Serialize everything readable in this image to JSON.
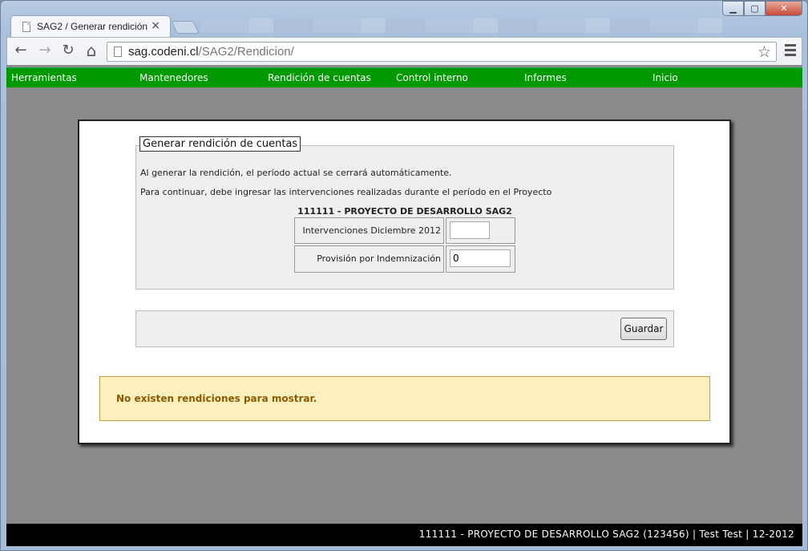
{
  "browser": {
    "tab_title": "SAG2 / Generar rendición",
    "tab_close": "×",
    "url_host": "sag.codeni.cl",
    "url_path": "/SAG2/Rendicion/",
    "window_buttons": {
      "minimize": "▁",
      "maximize": "▢",
      "close": "✕"
    },
    "nav": {
      "back": "←",
      "forward": "→",
      "reload": "↻",
      "home": "⌂",
      "star": "☆"
    }
  },
  "topnav": {
    "items": [
      "Herramientas",
      "Mantenedores",
      "Rendición de cuentas",
      "Control interno",
      "Informes",
      "Inicio"
    ]
  },
  "form": {
    "legend": "Generar rendición de cuentas",
    "intro_1": "Al generar la rendición, el período actual se cerrará automáticamente.",
    "intro_2": "Para continuar, debe ingresar las intervenciones realizadas durante el período en el Proyecto",
    "project_title": "111111 - PROYECTO DE DESARROLLO SAG2",
    "rows": [
      {
        "label": "Intervenciones Diciembre 2012",
        "value": ""
      },
      {
        "label": "Provisión por Indemnización",
        "value": "0"
      }
    ],
    "save_label": "Guardar"
  },
  "notice": {
    "message": "No existen rendiciones para mostrar."
  },
  "statusbar": {
    "text": "111111 - PROYECTO DE DESARROLLO SAG2 (123456) | Test Test | 12-2012"
  },
  "colors": {
    "nav_green": "#009900",
    "notice_bg": "#fdf0bd",
    "notice_text": "#8a5a00"
  }
}
